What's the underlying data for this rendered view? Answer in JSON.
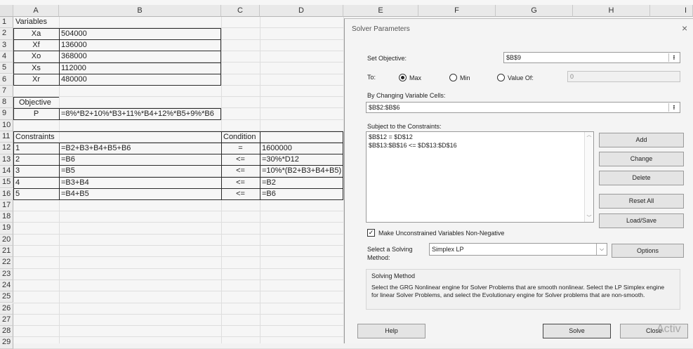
{
  "sheet": {
    "columns": [
      "A",
      "B",
      "C",
      "D",
      "E",
      "F",
      "G",
      "H",
      "I"
    ],
    "rows": [
      "1",
      "2",
      "3",
      "4",
      "5",
      "6",
      "7",
      "8",
      "9",
      "10",
      "11",
      "12",
      "13",
      "14",
      "15",
      "16",
      "17",
      "18",
      "19",
      "20",
      "21",
      "22",
      "23",
      "24",
      "25",
      "26",
      "27",
      "28",
      "29"
    ],
    "variables_header": "Variables",
    "variables": [
      {
        "name": "Xa",
        "value": "504000"
      },
      {
        "name": "Xf",
        "value": "136000"
      },
      {
        "name": "Xo",
        "value": "368000"
      },
      {
        "name": "Xs",
        "value": "112000"
      },
      {
        "name": "Xr",
        "value": "480000"
      }
    ],
    "objective_header": "Objective",
    "objective_name": "P",
    "objective_formula": "=8%*B2+10%*B3+11%*B4+12%*B5+9%*B6",
    "constraints_header": "Constraints",
    "condition_header": "Condition",
    "constraints": [
      {
        "id": "1",
        "lhs": "=B2+B3+B4+B5+B6",
        "cond": "=",
        "rhs": "1600000"
      },
      {
        "id": "2",
        "lhs": "=B6",
        "cond": "<=",
        "rhs": "=30%*D12"
      },
      {
        "id": "3",
        "lhs": "=B5",
        "cond": "<=",
        "rhs": "=10%*(B2+B3+B4+B5)"
      },
      {
        "id": "4",
        "lhs": "=B3+B4",
        "cond": "<=",
        "rhs": "=B2"
      },
      {
        "id": "5",
        "lhs": "=B4+B5",
        "cond": "<=",
        "rhs": "=B6"
      }
    ]
  },
  "dialog": {
    "title": "Solver Parameters",
    "close_glyph": "×",
    "set_objective_label": "Set Objective:",
    "set_objective_value": "$B$9",
    "to_label": "To:",
    "radio_max": "Max",
    "radio_min": "Min",
    "radio_value_of": "Value Of:",
    "value_of_value": "0",
    "changing_label": "By Changing Variable Cells:",
    "changing_value": "$B$2:$B$6",
    "subject_label": "Subject to the Constraints:",
    "constraints_list": [
      "$B$12 = $D$12",
      "$B$13:$B$16 <= $D$13:$D$16"
    ],
    "btn_add": "Add",
    "btn_change": "Change",
    "btn_delete": "Delete",
    "btn_reset": "Reset All",
    "btn_load": "Load/Save",
    "nonneg_label": "Make Unconstrained Variables Non-Negative",
    "method_label_1": "Select a Solving",
    "method_label_2": "Method:",
    "method_value": "Simplex LP",
    "btn_options": "Options",
    "solving_method_title": "Solving Method",
    "solving_method_text": "Select the GRG Nonlinear engine for Solver Problems that are smooth nonlinear. Select the LP Simplex engine for linear Solver Problems, and select the Evolutionary engine for Solver problems that are non-smooth.",
    "btn_help": "Help",
    "btn_solve": "Solve",
    "btn_close": "Close",
    "watermark": "Activ"
  }
}
